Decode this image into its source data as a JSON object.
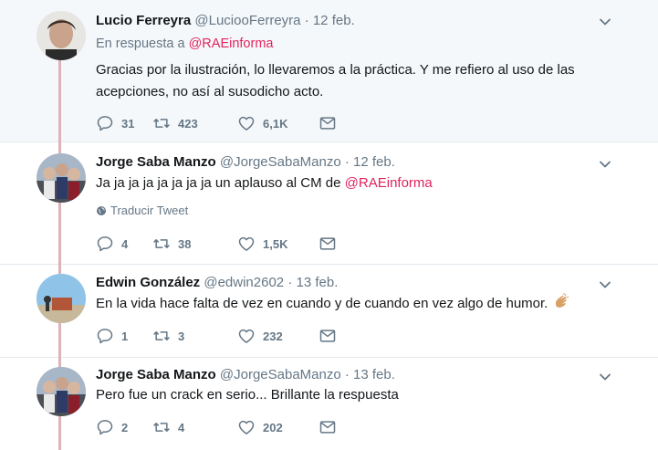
{
  "tweets": [
    {
      "name": "Lucio Ferreyra",
      "handle": "@LuciooFerreyra",
      "dot": "·",
      "date": "12 feb.",
      "reply_prefix": "En respuesta a",
      "reply_mention": "@RAEinforma",
      "text_line1": "Gracias por la ilustración, lo llevaremos a la práctica. Y me refiero al uso de las",
      "text_line2": "acepciones, no así al susodicho acto.",
      "replies": "31",
      "retweets": "423",
      "likes": "6,1K"
    },
    {
      "name": "Jorge Saba Manzo",
      "handle": "@JorgeSabaManzo",
      "dot": "·",
      "date": "12 feb.",
      "text": "Ja ja ja ja ja ja ja ja un aplauso al CM de",
      "text_mention": "@RAEinforma",
      "translate": "Traducir Tweet",
      "replies": "4",
      "retweets": "38",
      "likes": "1,5K"
    },
    {
      "name": "Edwin González",
      "handle": "@edwin2602",
      "dot": "·",
      "date": "13 feb.",
      "text": "En la vida hace falta de vez en cuando y de cuando en vez algo de humor.",
      "replies": "1",
      "retweets": "3",
      "likes": "232"
    },
    {
      "name": "Jorge Saba Manzo",
      "handle": "@JorgeSabaManzo",
      "dot": "·",
      "date": "13 feb.",
      "text": "Pero fue un crack en serio... Brillante la respuesta",
      "replies": "2",
      "retweets": "4",
      "likes": "202"
    }
  ],
  "colors": {
    "mention": "#e0245e",
    "muted": "#657786",
    "thread_line": "#ddb3ba",
    "highlight_bg": "#f5f8fa"
  },
  "icons": {
    "reply": "reply-icon",
    "retweet": "retweet-icon",
    "like": "heart-icon",
    "dm": "envelope-icon",
    "menu": "chevron-down-icon",
    "translate": "globe-icon"
  }
}
